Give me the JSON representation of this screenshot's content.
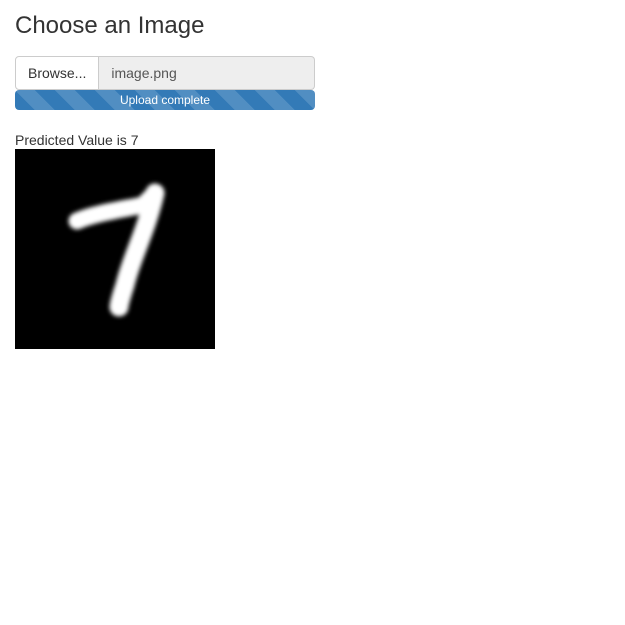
{
  "header": {
    "title": "Choose an Image"
  },
  "file_input": {
    "browse_label": "Browse...",
    "file_name": "image.png"
  },
  "upload": {
    "status_text": "Upload complete",
    "progress_fraction": 1.0,
    "bar_color": "#337ab7"
  },
  "result": {
    "prediction_text": "Predicted Value is 7"
  },
  "image": {
    "icon": "handwritten-digit-7-image"
  }
}
